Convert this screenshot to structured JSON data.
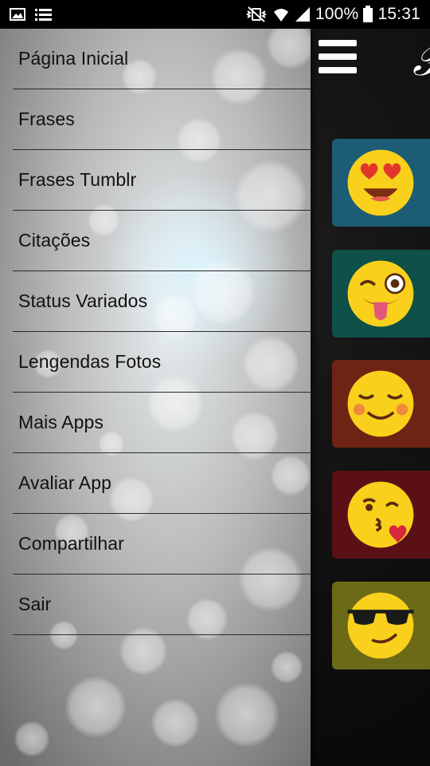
{
  "status_bar": {
    "battery_text": "100%",
    "time": "15:31",
    "icons": [
      "image-icon",
      "list-icon",
      "mute-vibrate-icon",
      "wifi-icon",
      "signal-icon",
      "battery-icon"
    ]
  },
  "drawer": {
    "items": [
      {
        "label": "Página Inicial"
      },
      {
        "label": "Frases"
      },
      {
        "label": "Frases Tumblr"
      },
      {
        "label": "Citações"
      },
      {
        "label": "Status Variados"
      },
      {
        "label": "Lengendas Fotos"
      },
      {
        "label": "Mais Apps"
      },
      {
        "label": "Avaliar App"
      },
      {
        "label": "Compartilhar"
      },
      {
        "label": "Sair"
      }
    ]
  },
  "main": {
    "menu_icon": "hamburger-menu-icon",
    "cards": [
      {
        "emoji": "heart-eyes-emoji",
        "color": "#1c5d75"
      },
      {
        "emoji": "wink-tongue-emoji",
        "color": "#0f5048"
      },
      {
        "emoji": "smiling-blush-emoji",
        "color": "#6e2414"
      },
      {
        "emoji": "kiss-heart-emoji",
        "color": "#5b1015"
      },
      {
        "emoji": "sunglasses-emoji",
        "color": "#6c6a17"
      }
    ]
  },
  "colors": {
    "emoji_yellow": "#f9d01c",
    "status_bar": "#000000",
    "menu_text": "#111111"
  }
}
